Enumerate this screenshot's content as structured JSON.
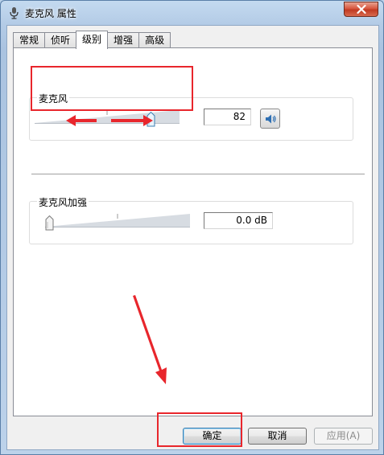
{
  "window": {
    "title": "麦克风 属性",
    "close_icon": "close-icon",
    "app_icon": "microphone-icon"
  },
  "tabs": [
    {
      "label": "常规",
      "active": false
    },
    {
      "label": "侦听",
      "active": false
    },
    {
      "label": "级别",
      "active": true
    },
    {
      "label": "增强",
      "active": false
    },
    {
      "label": "高级",
      "active": false
    }
  ],
  "microphone": {
    "label": "麦克风",
    "value": "82",
    "level": 82,
    "mute_icon": "speaker-icon"
  },
  "boost": {
    "label": "麦克风加强",
    "value": "0.0 dB",
    "level": 0
  },
  "buttons": {
    "ok": "确定",
    "cancel": "取消",
    "apply": "应用(A)"
  },
  "colors": {
    "annotation": "#e8262c",
    "thumb_accent": "#3c8fd4"
  }
}
